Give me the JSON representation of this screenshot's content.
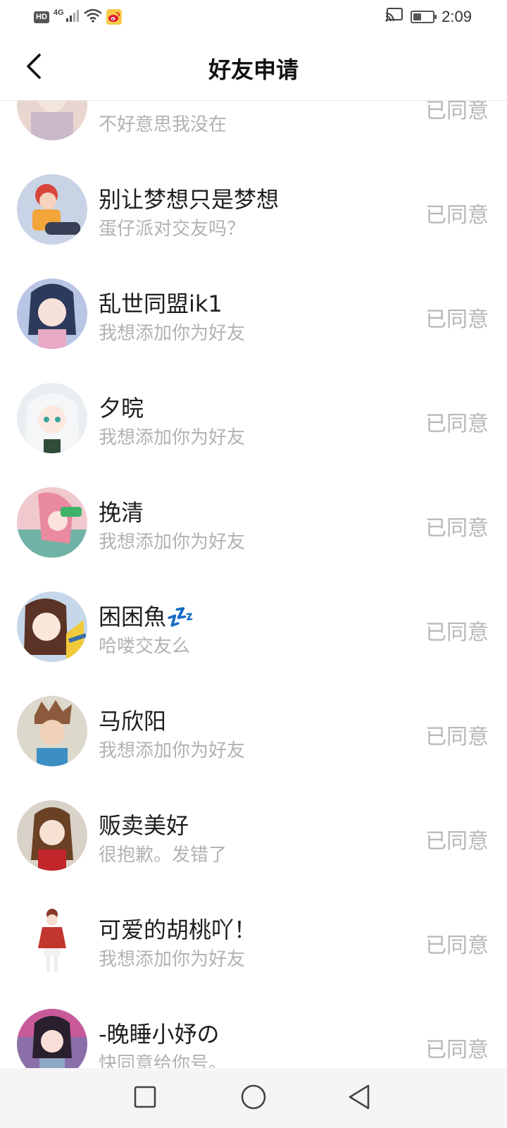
{
  "status_bar": {
    "hd": "HD",
    "network": "4G",
    "time": "2:09",
    "icons": [
      "signal-icon",
      "wifi-icon",
      "weibo-icon",
      "cast-icon",
      "battery-icon"
    ]
  },
  "header": {
    "title": "好友申请",
    "back_icon": "chevron-left-icon"
  },
  "requests": [
    {
      "name": "",
      "message": "不好意思我没在",
      "status": "已同意",
      "avatar_color": "#e9d6d0"
    },
    {
      "name": "别让梦想只是梦想",
      "message": "蛋仔派对交友吗？",
      "status": "已同意",
      "avatar_color": "#c9d3e6"
    },
    {
      "name": "乱世同盟ik1",
      "message": "我想添加你为好友",
      "status": "已同意",
      "avatar_color": "#b9c6e3"
    },
    {
      "name": "夕晥",
      "message": "我想添加你为好友",
      "status": "已同意",
      "avatar_color": "#e9eef0"
    },
    {
      "name": "挽清",
      "message": "我想添加你为好友",
      "status": "已同意",
      "avatar_color": "#f0c9cf"
    },
    {
      "name": "困困魚💤",
      "message": "哈喽交友么",
      "status": "已同意",
      "avatar_color": "#c6d7ea"
    },
    {
      "name": "马欣阳",
      "message": "我想添加你为好友",
      "status": "已同意",
      "avatar_color": "#dcd8cc"
    },
    {
      "name": "贩卖美好",
      "message": "很抱歉。发错了",
      "status": "已同意",
      "avatar_color": "#d9d2c8"
    },
    {
      "name": "可爱的胡桃吖！",
      "message": "我想添加你为好友",
      "status": "已同意",
      "avatar_color": "#ffffff"
    },
    {
      "name": "-晚睡小妤の",
      "message": "快同意给你号。",
      "status": "已同意",
      "avatar_color": "#8a6fa8"
    }
  ],
  "nav_bar": {
    "icons": [
      "recent-apps-icon",
      "home-icon",
      "back-icon"
    ]
  }
}
